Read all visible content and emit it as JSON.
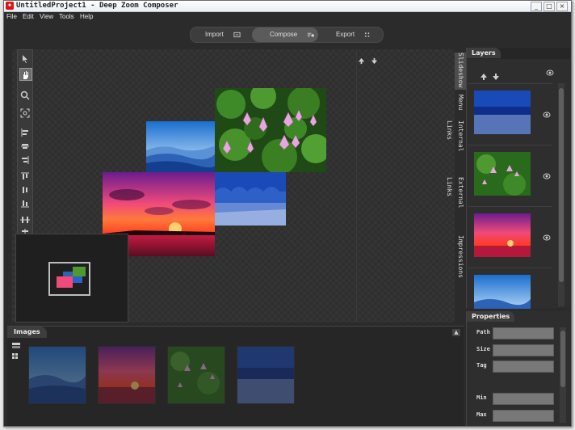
{
  "window": {
    "title": "UntitledProject1 - Deep Zoom Composer",
    "app_icon": "deep-zoom-composer-logo",
    "controls": [
      "minimize",
      "maximize",
      "close"
    ]
  },
  "menubar": [
    "File",
    "Edit",
    "View",
    "Tools",
    "Help"
  ],
  "modes": [
    {
      "label": "Import",
      "icon": "import-icon",
      "active": false
    },
    {
      "label": "Compose",
      "icon": "compose-icon",
      "active": true
    },
    {
      "label": "Export",
      "icon": "export-icon",
      "active": false
    }
  ],
  "toolbar_tools": [
    "select-arrow-icon",
    "pan-hand-icon",
    "zoom-icon",
    "fit-icon",
    "align-left-icon",
    "align-center-icon",
    "align-right-icon",
    "align-top-icon",
    "align-middle-icon",
    "align-bottom-icon",
    "distribute-horizontal-icon",
    "distribute-vertical-icon",
    "match-width-icon",
    "match-height-icon"
  ],
  "side_tabs": [
    "Slideshow",
    "Menu",
    "Internal Links",
    "External Links",
    "Impressions"
  ],
  "layers": {
    "title": "Layers",
    "items": [
      "blue-forest",
      "lotus-flowers",
      "pink-sunset",
      "blue-mountains"
    ]
  },
  "properties": {
    "title": "Properties",
    "fields": [
      "Path",
      "Size",
      "Tag",
      "Min",
      "Max"
    ]
  },
  "images_panel": {
    "title": "Images",
    "thumbnails": [
      "blue-mountains",
      "pink-sunset",
      "lotus-flowers",
      "blue-forest"
    ]
  },
  "colors": {
    "background": "#2b2b2b",
    "panel": "#2e2e2e",
    "text": "#e6e6e6"
  }
}
